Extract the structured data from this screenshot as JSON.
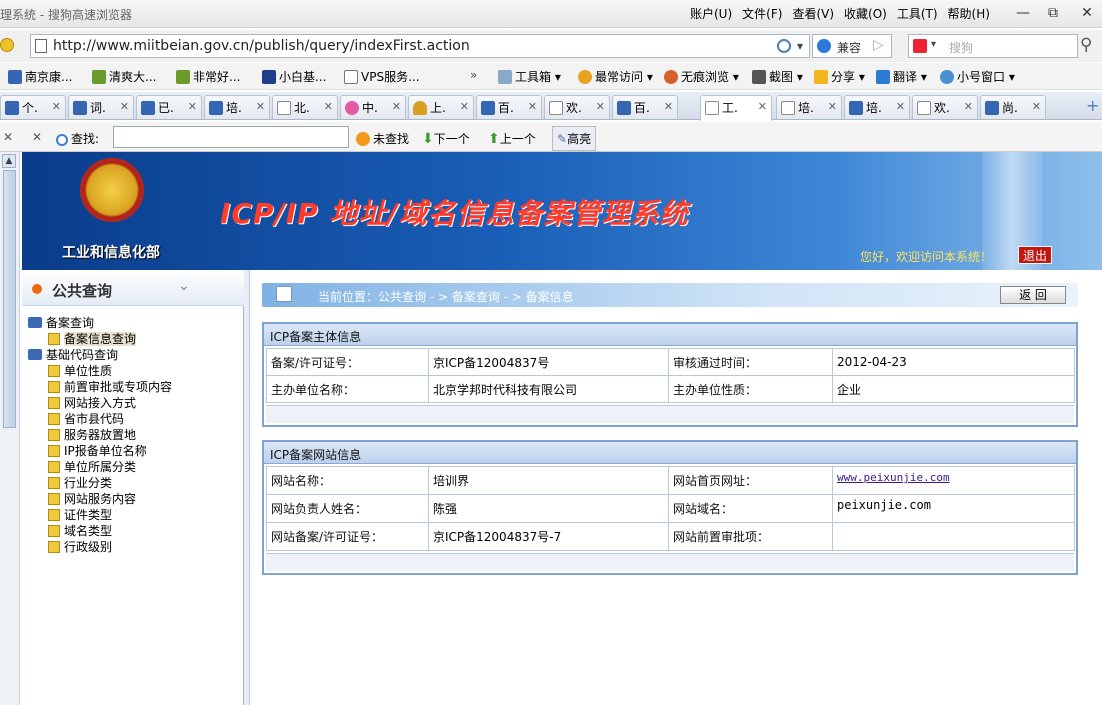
{
  "browser": {
    "title": "理系统 - 搜狗高速浏览器",
    "menus": [
      "账户(U)",
      "文件(F)",
      "查看(V)",
      "收藏(O)",
      "工具(T)",
      "帮助(H)"
    ],
    "url": "http://www.miitbeian.gov.cn/publish/query/indexFirst.action",
    "compat_label": "兼容",
    "search_placeholder": "搜狗",
    "bookmarks": [
      "南京康...",
      "清爽大...",
      "非常好...",
      "小白基...",
      "VPS服务..."
    ],
    "tools": [
      "工具箱",
      "最常访问",
      "无痕浏览",
      "截图",
      "分享",
      "翻译",
      "小号窗口"
    ],
    "tabs": [
      "个.",
      "词.",
      "已.",
      "培.",
      "北.",
      "中.",
      "上.",
      "百.",
      "欢.",
      "百.",
      "工.",
      "培.",
      "培.",
      "欢.",
      "尚."
    ],
    "active_tab_index": 10,
    "find": {
      "label": "查找:",
      "value": "",
      "not_found": "未查找",
      "next": "下一个",
      "prev": "上一个",
      "highlight": "高亮"
    }
  },
  "banner": {
    "system_title": "ICP/IP 地址/域名信息备案管理系统",
    "ministry": "工业和信息化部",
    "welcome": "您好，欢迎访问本系统！",
    "logout": "退出"
  },
  "sidebar": {
    "header": "公共查询",
    "items": [
      {
        "label": "备案查询",
        "level": 0
      },
      {
        "label": "备案信息查询",
        "level": 1,
        "selected": true
      },
      {
        "label": "基础代码查询",
        "level": 0
      },
      {
        "label": "单位性质",
        "level": 1
      },
      {
        "label": "前置审批或专项内容",
        "level": 1
      },
      {
        "label": "网站接入方式",
        "level": 1
      },
      {
        "label": "省市县代码",
        "level": 1
      },
      {
        "label": "服务器放置地",
        "level": 1
      },
      {
        "label": "IP报备单位名称",
        "level": 1
      },
      {
        "label": "单位所属分类",
        "level": 1
      },
      {
        "label": "行业分类",
        "level": 1
      },
      {
        "label": "网站服务内容",
        "level": 1
      },
      {
        "label": "证件类型",
        "level": 1
      },
      {
        "label": "域名类型",
        "level": 1
      },
      {
        "label": "行政级别",
        "level": 1
      }
    ]
  },
  "breadcrumb": "当前位置：公共查询  - >  备案查询  - >  备案信息",
  "back_label": "返  回",
  "entity_panel": {
    "title": "ICP备案主体信息",
    "rows": [
      [
        "备案/许可证号：",
        "京ICP备12004837号",
        "审核通过时间：",
        "2012-04-23"
      ],
      [
        "主办单位名称：",
        "北京学邦时代科技有限公司",
        "主办单位性质：",
        "企业"
      ]
    ]
  },
  "site_panel": {
    "title": "ICP备案网站信息",
    "rows": [
      [
        "网站名称：",
        "培训界",
        "网站首页网址：",
        "www.peixunjie.com"
      ],
      [
        "网站负责人姓名：",
        "陈强",
        "网站域名：",
        "peixunjie.com"
      ],
      [
        "网站备案/许可证号：",
        "京ICP备12004837号-7",
        "网站前置审批项：",
        ""
      ]
    ]
  }
}
